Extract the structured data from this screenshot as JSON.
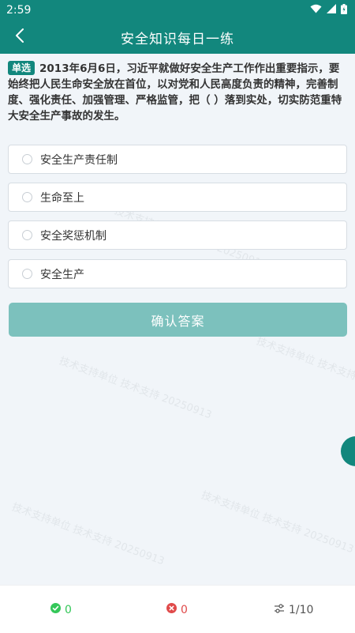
{
  "status_bar": {
    "time": "2:59"
  },
  "header": {
    "title": "安全知识每日一练"
  },
  "question": {
    "tag": "单选",
    "text": "2013年6月6日，习近平就做好安全生产工作作出重要指示，要始终把人民生命安全放在首位，以对党和人民高度负责的精神，完善制度、强化责任、加强管理、严格监管，把（ ）落到实处，切实防范重特大安全生产事故的发生。"
  },
  "options": [
    {
      "label": "安全生产责任制"
    },
    {
      "label": "生命至上"
    },
    {
      "label": "安全奖惩机制"
    },
    {
      "label": "安全生产"
    }
  ],
  "confirm_label": "确认答案",
  "watermark": {
    "text": "技术支持单位 技术支持 20250913"
  },
  "footer": {
    "correct_count": "0",
    "wrong_count": "0",
    "progress": "1/10"
  },
  "colors": {
    "primary": "#12877d",
    "confirm_disabled": "#7cc1bd",
    "correct": "#34c759",
    "wrong": "#e04a4a"
  },
  "icons": [
    "wifi-icon",
    "signal-icon",
    "battery-icon",
    "back-arrow-icon",
    "check-circle-icon",
    "close-circle-icon",
    "settings-sliders-icon"
  ]
}
